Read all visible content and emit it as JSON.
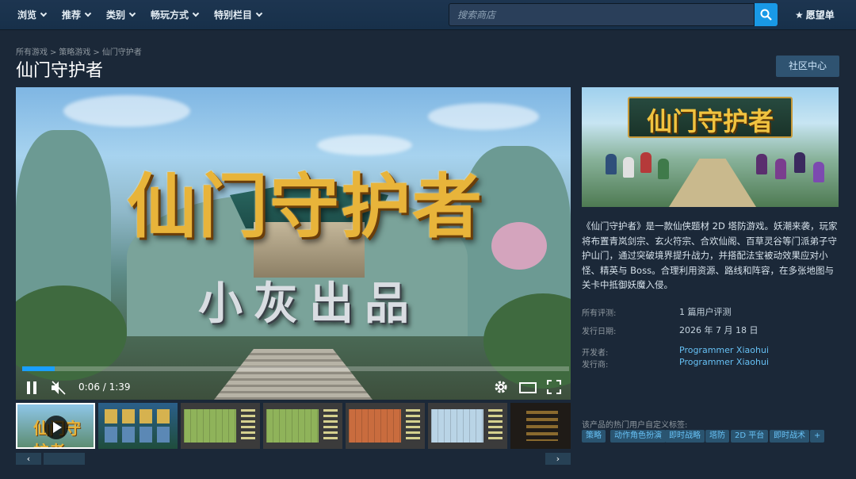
{
  "nav": {
    "items": [
      {
        "label": "浏览",
        "icon": "chevron-down-icon"
      },
      {
        "label": "推荐",
        "icon": "chevron-down-icon"
      },
      {
        "label": "类别",
        "icon": "chevron-down-icon"
      },
      {
        "label": "畅玩方式",
        "icon": "chevron-down-icon"
      },
      {
        "label": "特别栏目",
        "icon": "chevron-down-icon"
      }
    ],
    "search_placeholder": "搜索商店",
    "search_icon": "search-icon",
    "wishlist_label": "愿望单",
    "wishlist_icon": "star-icon"
  },
  "breadcrumb": [
    "所有游戏",
    "策略游戏",
    "仙门守护者"
  ],
  "title": "仙门守护者",
  "community_button": "社区中心",
  "video": {
    "title_art": "仙门守护者",
    "subtitle_art": "小灰出品",
    "time": "0:06 / 1:39",
    "progress": 0.06,
    "controls": [
      "pause-icon",
      "mute-icon",
      "gear-icon",
      "window-icon",
      "fullscreen-icon"
    ]
  },
  "thumbnails": {
    "first_title": "仙门守护者",
    "count": 7
  },
  "capsule_title": "仙门守护者",
  "description": "《仙门守护者》是一款仙侠题材 2D 塔防游戏。妖潮来袭，玩家将布置青岚剑宗、玄火符宗、合欢仙阁、百草灵谷等门派弟子守护山门，通过突破境界提升战力，并搭配法宝被动效果应对小怪、精英与 Boss。合理利用资源、路线和阵容，在多张地图与关卡中抵御妖魔入侵。",
  "info": {
    "reviews_label": "所有评测:",
    "reviews_value": "1 篇用户评测",
    "release_label": "发行日期:",
    "release_value": "2026 年 7 月 18 日",
    "developer_label": "开发者:",
    "developer_value": "Programmer Xiaohui",
    "publisher_label": "发行商:",
    "publisher_value": "Programmer Xiaohui"
  },
  "tags": {
    "label": "该产品的热门用户自定义标签:",
    "items": [
      "策略",
      "动作角色扮演",
      "即时战略",
      "塔防",
      "2D 平台",
      "即时战术",
      "+"
    ]
  },
  "colors": {
    "background": "#1b2838",
    "nav": "#17304a",
    "accent_blue": "#1999e6",
    "link": "#66c0f4",
    "tag_bg": "#2a5470"
  }
}
